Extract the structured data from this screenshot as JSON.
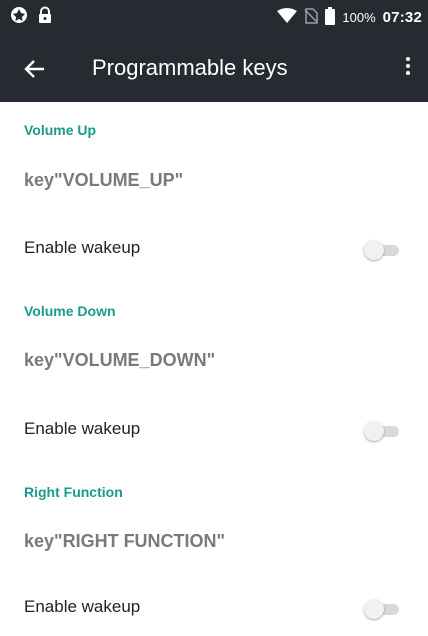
{
  "status_bar": {
    "battery": "100%",
    "time": "07:32",
    "icons": [
      "aperture-icon",
      "lock-icon",
      "wifi-icon",
      "no-sim-icon",
      "battery-icon"
    ]
  },
  "toolbar": {
    "title": "Programmable keys",
    "icons": [
      "back-arrow-icon",
      "more-vert-icon"
    ]
  },
  "sections": [
    {
      "header": "Volume Up",
      "key": "key\"VOLUME_UP\"",
      "wakeup_label": "Enable wakeup",
      "wakeup_enabled": false
    },
    {
      "header": "Volume Down",
      "key": "key\"VOLUME_DOWN\"",
      "wakeup_label": "Enable wakeup",
      "wakeup_enabled": false
    },
    {
      "header": "Right Function",
      "key": "key\"RIGHT FUNCTION\"",
      "wakeup_label": "Enable wakeup",
      "wakeup_enabled": false
    }
  ],
  "colors": {
    "bar_bg": "#252b30",
    "accent": "#1a9a8a",
    "key_text": "#7a7a7a"
  }
}
